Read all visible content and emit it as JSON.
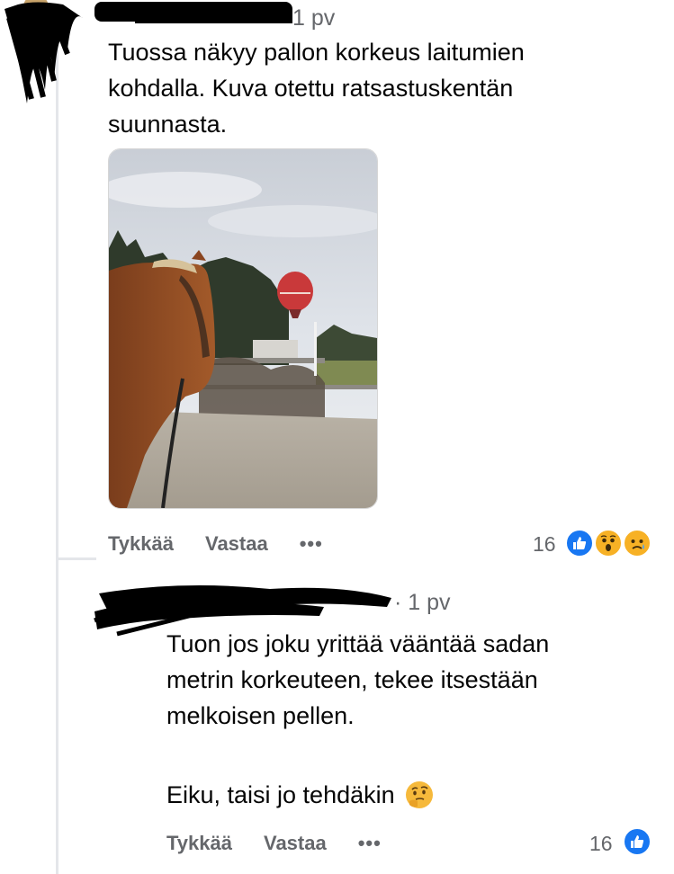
{
  "comment1": {
    "timestamp": "1 pv",
    "text_lines": [
      "Tuossa näkyy pallon korkeus laitumien",
      "kohdalla. Kuva otettu ratsastuskentän",
      "suunnasta."
    ],
    "actions": {
      "like": "Tykkää",
      "reply": "Vastaa",
      "more": "•••"
    },
    "reaction_count": "16",
    "reactions": [
      "like-icon",
      "wow-icon",
      "sad-icon"
    ]
  },
  "comment2": {
    "timestamp": "· 1 pv",
    "text_lines": [
      "Tuon jos joku yrittää vääntää sadan",
      "metrin korkeuteen, tekee itsestään",
      "melkoisen pellen."
    ],
    "text_line2": "Eiku, taisi jo tehdäkin",
    "emoji": "thinking-face-icon",
    "actions": {
      "like": "Tykkää",
      "reply": "Vastaa",
      "more": "•••"
    },
    "reaction_count": "16",
    "reactions": [
      "like-icon"
    ]
  },
  "colors": {
    "like": "#1877f2",
    "meta": "#65676b",
    "reaction_yellow": "#f7b125"
  }
}
